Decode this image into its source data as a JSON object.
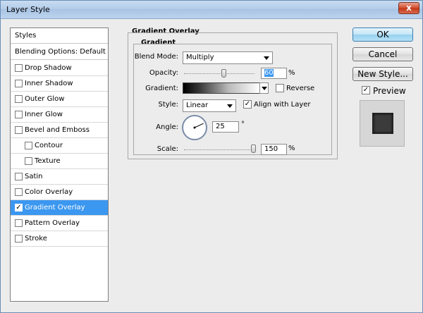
{
  "window": {
    "title": "Layer Style",
    "close_glyph": "x"
  },
  "left_panel": {
    "header_styles": "Styles",
    "header_blending": "Blending Options: Default",
    "items": [
      {
        "label": "Drop Shadow",
        "checked": false,
        "indent": false,
        "selected": false
      },
      {
        "label": "Inner Shadow",
        "checked": false,
        "indent": false,
        "selected": false
      },
      {
        "label": "Outer Glow",
        "checked": false,
        "indent": false,
        "selected": false
      },
      {
        "label": "Inner Glow",
        "checked": false,
        "indent": false,
        "selected": false
      },
      {
        "label": "Bevel and Emboss",
        "checked": false,
        "indent": false,
        "selected": false
      },
      {
        "label": "Contour",
        "checked": false,
        "indent": true,
        "selected": false
      },
      {
        "label": "Texture",
        "checked": false,
        "indent": true,
        "selected": false
      },
      {
        "label": "Satin",
        "checked": false,
        "indent": false,
        "selected": false
      },
      {
        "label": "Color Overlay",
        "checked": false,
        "indent": false,
        "selected": false
      },
      {
        "label": "Gradient Overlay",
        "checked": true,
        "indent": false,
        "selected": true
      },
      {
        "label": "Pattern Overlay",
        "checked": false,
        "indent": false,
        "selected": false
      },
      {
        "label": "Stroke",
        "checked": false,
        "indent": false,
        "selected": false
      }
    ]
  },
  "main": {
    "section_title": "Gradient Overlay",
    "group_title": "Gradient",
    "blend_mode": {
      "label": "Blend Mode:",
      "value": "Multiply"
    },
    "opacity": {
      "label": "Opacity:",
      "value": "60",
      "unit": "%",
      "level": 0.6
    },
    "gradient": {
      "label": "Gradient:",
      "reverse_label": "Reverse",
      "reverse_checked": false
    },
    "style": {
      "label": "Style:",
      "value": "Linear",
      "align_label": "Align with Layer",
      "align_checked": true
    },
    "angle": {
      "label": "Angle:",
      "value": "25",
      "unit": "°"
    },
    "scale": {
      "label": "Scale:",
      "value": "150",
      "unit": "%",
      "level": 1.0
    }
  },
  "buttons": {
    "ok": "OK",
    "cancel": "Cancel",
    "new_style": "New Style..."
  },
  "preview": {
    "label": "Preview",
    "checked": true
  },
  "colors": {
    "selection": "#3b97f0",
    "accent_border": "#3c7fb1"
  }
}
